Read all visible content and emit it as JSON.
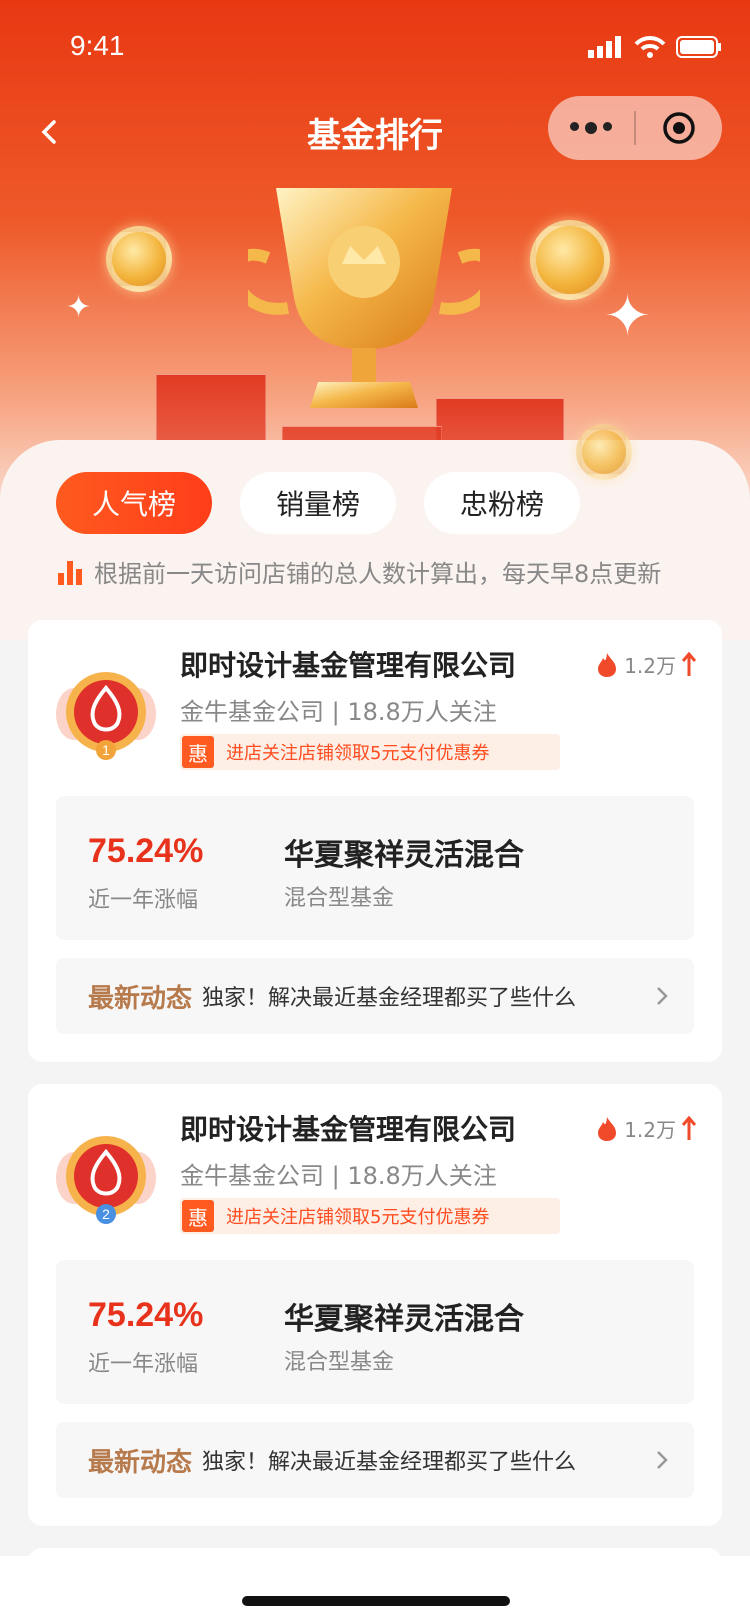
{
  "status": {
    "time": "9:41"
  },
  "nav": {
    "title": "基金排行"
  },
  "tabs": [
    {
      "label": "人气榜",
      "active": true
    },
    {
      "label": "销量榜",
      "active": false
    },
    {
      "label": "忠粉榜",
      "active": false
    }
  ],
  "hint": "根据前一天访问店铺的总人数计算出，每天早8点更新",
  "cards": [
    {
      "rank": "1",
      "company": "即时设计基金管理有限公司",
      "hot_count": "1.2万",
      "meta": "金牛基金公司 | 18.8万人关注",
      "coupon_tag": "惠",
      "coupon_text": "进店关注店铺领取5元支付优惠券",
      "pct": "75.24%",
      "pct_label": "近一年涨幅",
      "fund_name": "华夏聚祥灵活混合",
      "fund_type": "混合型基金",
      "news_tag": "最新动态",
      "news_text": "独家！解决最近基金经理都买了些什么"
    },
    {
      "rank": "2",
      "company": "即时设计基金管理有限公司",
      "hot_count": "1.2万",
      "meta": "金牛基金公司 | 18.8万人关注",
      "coupon_tag": "惠",
      "coupon_text": "进店关注店铺领取5元支付优惠券",
      "pct": "75.24%",
      "pct_label": "近一年涨幅",
      "fund_name": "华夏聚祥灵活混合",
      "fund_type": "混合型基金",
      "news_tag": "最新动态",
      "news_text": "独家！解决最近基金经理都买了些什么"
    }
  ],
  "colors": {
    "accent": "#ff5a1f",
    "pct": "#e8321b",
    "news_tag": "#b77a4d"
  }
}
